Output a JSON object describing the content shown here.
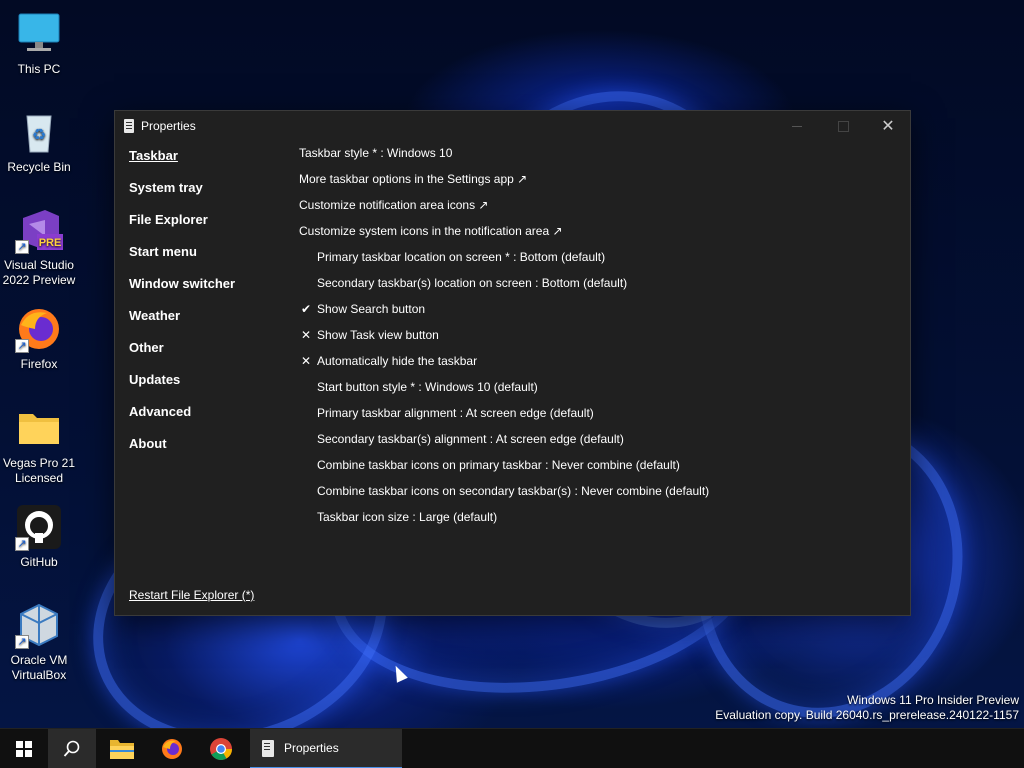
{
  "desktop": {
    "icons": [
      {
        "label": "This PC",
        "icon": "monitor-icon"
      },
      {
        "label": "Recycle Bin",
        "icon": "recycle-bin-icon"
      },
      {
        "label": "Visual Studio 2022 Preview",
        "icon": "visual-studio-icon",
        "badge": "PRE"
      },
      {
        "label": "Firefox",
        "icon": "firefox-icon"
      },
      {
        "label": "Vegas Pro 21 Licensed",
        "icon": "folder-icon"
      },
      {
        "label": "GitHub",
        "icon": "github-icon"
      },
      {
        "label": "Oracle VM VirtualBox",
        "icon": "virtualbox-icon"
      }
    ]
  },
  "window": {
    "title": "Properties",
    "nav": [
      {
        "label": "Taskbar",
        "active": true
      },
      {
        "label": "System tray"
      },
      {
        "label": "File Explorer"
      },
      {
        "label": "Start menu"
      },
      {
        "label": "Window switcher"
      },
      {
        "label": "Weather"
      },
      {
        "label": "Other"
      },
      {
        "label": "Updates"
      },
      {
        "label": "Advanced"
      },
      {
        "label": "About"
      }
    ],
    "options": [
      {
        "text": "Taskbar style * : Windows 10",
        "mark": ""
      },
      {
        "text": "More taskbar options in the Settings app ↗",
        "mark": ""
      },
      {
        "text": "Customize notification area icons ↗",
        "mark": ""
      },
      {
        "text": "Customize system icons in the notification area ↗",
        "mark": ""
      },
      {
        "text": "Primary taskbar location on screen * : Bottom (default)",
        "mark": ""
      },
      {
        "text": "Secondary taskbar(s) location on screen : Bottom (default)",
        "mark": ""
      },
      {
        "text": "Show Search button",
        "mark": "✔"
      },
      {
        "text": "Show Task view button",
        "mark": "✕"
      },
      {
        "text": "Automatically hide the taskbar",
        "mark": "✕"
      },
      {
        "text": "Start button style * : Windows 10 (default)",
        "mark": ""
      },
      {
        "text": "Primary taskbar alignment : At screen edge (default)",
        "mark": ""
      },
      {
        "text": "Secondary taskbar(s) alignment : At screen edge (default)",
        "mark": ""
      },
      {
        "text": "Combine taskbar icons on primary taskbar : Never combine (default)",
        "mark": ""
      },
      {
        "text": "Combine taskbar icons on secondary taskbar(s) : Never combine (default)",
        "mark": ""
      },
      {
        "text": "Taskbar icon size : Large (default)",
        "mark": ""
      }
    ],
    "restart_link": "Restart File Explorer (*)"
  },
  "watermark": {
    "line1": "Windows 11 Pro Insider Preview",
    "line2": "Evaluation copy. Build 26040.rs_prerelease.240122-1157"
  },
  "taskbar": {
    "items": [
      "start-icon",
      "search-icon",
      "file-explorer-icon",
      "firefox-icon",
      "chrome-icon"
    ],
    "active_task": "Properties"
  },
  "colors": {
    "window_bg": "#202020",
    "taskbar_bg": "#101010",
    "accent": "#4a90e8"
  }
}
